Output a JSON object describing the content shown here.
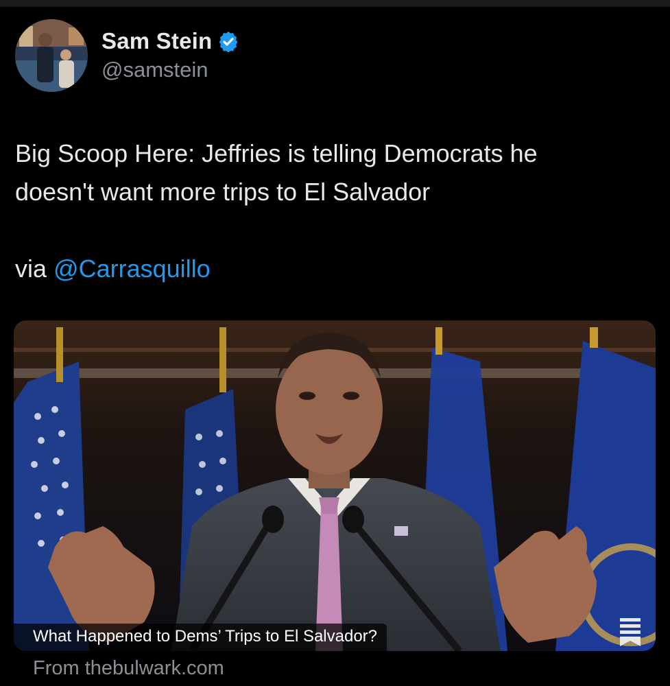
{
  "tweet": {
    "author": {
      "display_name": "Sam Stein",
      "handle": "@samstein",
      "verified": true,
      "avatar_icon": "profile-photo"
    },
    "text_lines": [
      "Big Scoop Here: Jeffries is telling Democrats he",
      "doesn't want more trips to El Salvador"
    ],
    "via_prefix": "via ",
    "via_mention": "@Carrasquillo"
  },
  "link_card": {
    "title": "What Happened to Dems’ Trips to El Salvador?",
    "source": "From thebulwark.com",
    "image_icon": "press-conference-photo",
    "overlay_icon": "bookmark-lines-icon"
  },
  "colors": {
    "background": "#000000",
    "text": "#e7e9ea",
    "secondary_text": "#8b9097",
    "link": "#1d9bf0",
    "verified_badge": "#1d9bf0"
  }
}
